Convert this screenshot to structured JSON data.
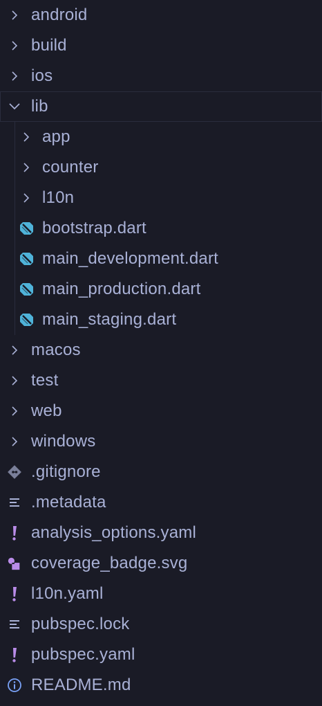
{
  "explorer": {
    "items": [
      {
        "label": "android",
        "kind": "folder",
        "state": "collapsed",
        "depth": 0,
        "icon": "chevron-right-icon"
      },
      {
        "label": "build",
        "kind": "folder",
        "state": "collapsed",
        "depth": 0,
        "icon": "chevron-right-icon"
      },
      {
        "label": "ios",
        "kind": "folder",
        "state": "collapsed",
        "depth": 0,
        "icon": "chevron-right-icon"
      },
      {
        "label": "lib",
        "kind": "folder",
        "state": "expanded",
        "depth": 0,
        "icon": "chevron-down-icon",
        "selected": true
      },
      {
        "label": "app",
        "kind": "folder",
        "state": "collapsed",
        "depth": 1,
        "icon": "chevron-right-icon"
      },
      {
        "label": "counter",
        "kind": "folder",
        "state": "collapsed",
        "depth": 1,
        "icon": "chevron-right-icon"
      },
      {
        "label": "l10n",
        "kind": "folder",
        "state": "collapsed",
        "depth": 1,
        "icon": "chevron-right-icon"
      },
      {
        "label": "bootstrap.dart",
        "kind": "file",
        "depth": 1,
        "icon": "dart-icon"
      },
      {
        "label": "main_development.dart",
        "kind": "file",
        "depth": 1,
        "icon": "dart-icon"
      },
      {
        "label": "main_production.dart",
        "kind": "file",
        "depth": 1,
        "icon": "dart-icon"
      },
      {
        "label": "main_staging.dart",
        "kind": "file",
        "depth": 1,
        "icon": "dart-icon"
      },
      {
        "label": "macos",
        "kind": "folder",
        "state": "collapsed",
        "depth": 0,
        "icon": "chevron-right-icon"
      },
      {
        "label": "test",
        "kind": "folder",
        "state": "collapsed",
        "depth": 0,
        "icon": "chevron-right-icon"
      },
      {
        "label": "web",
        "kind": "folder",
        "state": "collapsed",
        "depth": 0,
        "icon": "chevron-right-icon"
      },
      {
        "label": "windows",
        "kind": "folder",
        "state": "collapsed",
        "depth": 0,
        "icon": "chevron-right-icon"
      },
      {
        "label": ".gitignore",
        "kind": "file",
        "depth": 0,
        "icon": "git-icon"
      },
      {
        "label": ".metadata",
        "kind": "file",
        "depth": 0,
        "icon": "lines-icon"
      },
      {
        "label": "analysis_options.yaml",
        "kind": "file",
        "depth": 0,
        "icon": "exclamation-icon"
      },
      {
        "label": "coverage_badge.svg",
        "kind": "file",
        "depth": 0,
        "icon": "svg-shapes-icon"
      },
      {
        "label": "l10n.yaml",
        "kind": "file",
        "depth": 0,
        "icon": "exclamation-icon"
      },
      {
        "label": "pubspec.lock",
        "kind": "file",
        "depth": 0,
        "icon": "lines-icon"
      },
      {
        "label": "pubspec.yaml",
        "kind": "file",
        "depth": 0,
        "icon": "exclamation-icon"
      },
      {
        "label": "README.md",
        "kind": "file",
        "depth": 0,
        "icon": "info-icon"
      }
    ]
  },
  "colors": {
    "background": "#1a1b26",
    "text": "#a9b1d6",
    "chevron": "#a9b1d6",
    "dart": "#4fb3d9",
    "git": "#7a7f99",
    "yaml": "#b98ce8",
    "svg": "#b98ce8",
    "info": "#7aa2f7",
    "lines": "#a9b1d6",
    "selected_outline": "#2a2c3d"
  }
}
